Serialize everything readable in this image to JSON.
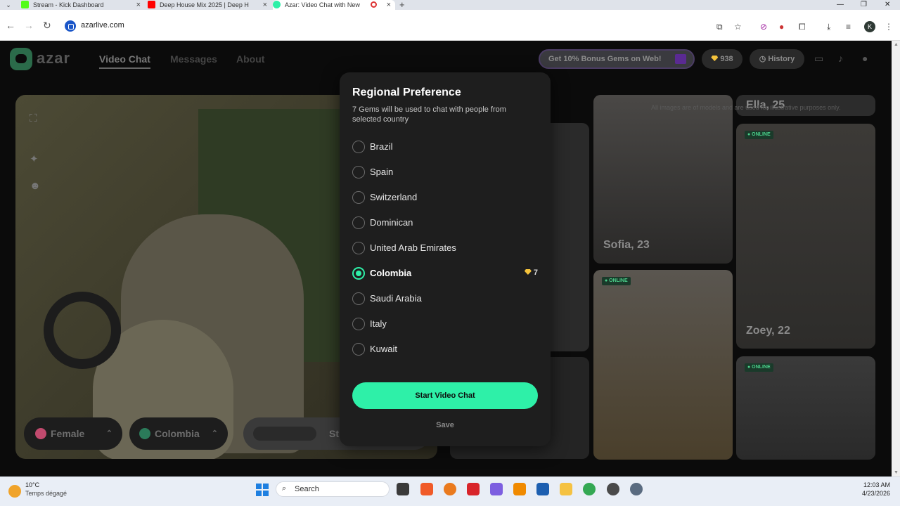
{
  "browser": {
    "tabs": [
      {
        "title": "Stream - Kick Dashboard",
        "favicon_color": "#53fc18"
      },
      {
        "title": "Deep House Mix 2025 | Deep H",
        "favicon_color": "#ff0000"
      },
      {
        "title": "Azar: Video Chat with New",
        "favicon_color": "#2ef0a8"
      }
    ],
    "new_tab": "+",
    "url": "azarlive.com",
    "profile_initial": "K"
  },
  "site": {
    "logo_text": "azar",
    "nav": [
      {
        "label": "Video Chat",
        "active": true
      },
      {
        "label": "Messages",
        "active": false
      },
      {
        "label": "About",
        "active": false
      }
    ],
    "promo_label": "Get 10% Bonus Gems on Web!",
    "gems_count": "938",
    "history_label": "History"
  },
  "filters": {
    "gender_label": "Female",
    "country_label": "Colombia",
    "start_partial": "St"
  },
  "cards": {
    "disclaimer": "All images are of models and are used for illustrative purposes only.",
    "people": [
      {
        "label": "Ella, 25"
      },
      {
        "label": "Sofia, 23"
      },
      {
        "label": "Zoey, 22"
      }
    ],
    "online_badge": "● ONLINE"
  },
  "modal": {
    "title": "Regional Preference",
    "subtitle": "7 Gems will be used to chat with people from selected country",
    "options": [
      {
        "name": "Brazil",
        "selected": false
      },
      {
        "name": "Spain",
        "selected": false
      },
      {
        "name": "Switzerland",
        "selected": false
      },
      {
        "name": "Dominican",
        "selected": false
      },
      {
        "name": "United Arab Emirates",
        "selected": false
      },
      {
        "name": "Colombia",
        "selected": true,
        "cost": "7"
      },
      {
        "name": "Saudi Arabia",
        "selected": false
      },
      {
        "name": "Italy",
        "selected": false
      },
      {
        "name": "Kuwait",
        "selected": false
      }
    ],
    "start_button": "Start Video Chat",
    "save_button": "Save",
    "accent_color": "#2ef0a8"
  },
  "taskbar": {
    "weather_temp": "10°C",
    "weather_desc": "Temps dégagé",
    "search_placeholder": "Search",
    "time": "12:03 AM",
    "date": "4/23/2026"
  }
}
